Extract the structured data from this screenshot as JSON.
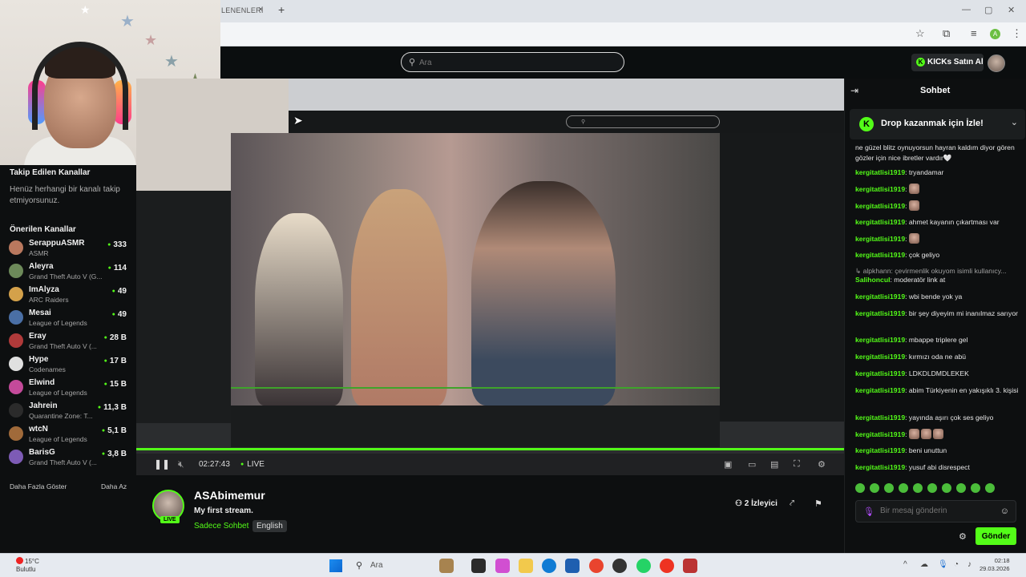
{
  "browser": {
    "tab_title": "LENENLERİ",
    "tab_close": "×",
    "new_tab": "+",
    "window_controls": [
      "—",
      "▢",
      "✕"
    ],
    "toolbar_icons": [
      "star-icon",
      "extensions-icon",
      "media-icon"
    ],
    "profile_initial": "A",
    "menu": "⋮"
  },
  "header": {
    "search_placeholder": "Ara",
    "kicks_button": "KICKs Satın Al"
  },
  "sidebar": {
    "followed_title": "Takip Edilen Kanallar",
    "followed_empty": "Henüz herhangi bir kanalı takip etmiyorsunuz.",
    "recommended_title": "Önerilen Kanallar",
    "channels": [
      {
        "name": "SerappuASMR",
        "game": "ASMR",
        "viewers": "333",
        "color": "#b9785e"
      },
      {
        "name": "Aleyra",
        "game": "Grand Theft Auto V (G...",
        "viewers": "114",
        "color": "#6d8a5a"
      },
      {
        "name": "ImAlyza",
        "game": "ARC Raiders",
        "viewers": "49",
        "color": "#d4a14a"
      },
      {
        "name": "Mesai",
        "game": "League of Legends",
        "viewers": "49",
        "color": "#4a6fa5"
      },
      {
        "name": "Eray",
        "game": "Grand Theft Auto V (...",
        "viewers": "28 B",
        "color": "#b03a3a"
      },
      {
        "name": "Hype",
        "game": "Codenames",
        "viewers": "17 B",
        "color": "#e0e0e0"
      },
      {
        "name": "Elwind",
        "game": "League of Legends",
        "viewers": "15 B",
        "color": "#c44a9a"
      },
      {
        "name": "Jahrein",
        "game": "Quarantine Zone: T...",
        "viewers": "11,3 B",
        "color": "#2b2b2b"
      },
      {
        "name": "wtcN",
        "game": "League of Legends",
        "viewers": "5,1 B",
        "color": "#a06a3a"
      },
      {
        "name": "BarisG",
        "game": "Grand Theft Auto V (...",
        "viewers": "3,8 B",
        "color": "#7d5bb5"
      }
    ],
    "show_more": "Daha Fazla Göster",
    "show_less": "Daha Az"
  },
  "player": {
    "time": "02:27:43",
    "live": "LIVE",
    "progress": 1.0
  },
  "stream_info": {
    "streamer": "ASAbimemur",
    "title": "My first stream.",
    "category": "Sadece Sohbet",
    "language": "English",
    "live_badge": "LIVE",
    "viewers": "2 İzleyici"
  },
  "chat": {
    "title": "Sohbet",
    "drop_banner": "Drop kazanmak için İzle!",
    "messages": [
      {
        "user": "",
        "text": "ne güzel blitz oynuyorsun hayran kaldım diyor gören gözler için nice ibretler vardır🤍",
        "emotes": 0
      },
      {
        "user": "kergitatlisi1919",
        "text": "tryandamar",
        "emotes": 0
      },
      {
        "user": "kergitatlisi1919",
        "text": "",
        "emotes": 1
      },
      {
        "user": "kergitatlisi1919",
        "text": "",
        "emotes": 1
      },
      {
        "user": "kergitatlisi1919",
        "text": "ahmet kayanın çıkartması var",
        "emotes": 0
      },
      {
        "user": "kergitatlisi1919",
        "text": "",
        "emotes": 1
      },
      {
        "user": "kergitatlisi1919",
        "text": "çok geliyo",
        "emotes": 0
      },
      {
        "user": "",
        "text": "↳ alpkhann: çevirmenlik okuyom isimli kullanıcy...",
        "emotes": 0,
        "system": true
      },
      {
        "user": "Salihoncul",
        "text": "moderatör link at",
        "emotes": 0
      },
      {
        "user": "kergitatlisi1919",
        "text": "wbi bende yok ya",
        "emotes": 0
      },
      {
        "user": "kergitatlisi1919",
        "text": "bir şey diyeyim mi inanılmaz sarıyor",
        "emotes": 0
      },
      {
        "user": "kergitatlisi1919",
        "text": "mbappe triplere gel",
        "emotes": 0
      },
      {
        "user": "kergitatlisi1919",
        "text": "kırmızı oda ne abü",
        "emotes": 0
      },
      {
        "user": "kergitatlisi1919",
        "text": "LDKDLDMDLEKEK",
        "emotes": 0
      },
      {
        "user": "kergitatlisi1919",
        "text": "abim Türkiyenin en yakışıklı 3. kişisi",
        "emotes": 0
      },
      {
        "user": "kergitatlisi1919",
        "text": "yayında aşırı çok ses geliyo",
        "emotes": 0
      },
      {
        "user": "kergitatlisi1919",
        "text": "",
        "emotes": 3
      },
      {
        "user": "kergitatlisi1919",
        "text": "beni unuttun",
        "emotes": 0
      },
      {
        "user": "kergitatlisi1919",
        "text": "yusuf abi disrespect",
        "emotes": 0
      }
    ],
    "input_placeholder": "Bir mesaj gönderin",
    "send_button": "Gönder"
  },
  "taskbar": {
    "weather_temp": "15°C",
    "weather_desc": "Bulutlu",
    "search_label": "Ara",
    "time": "02:18",
    "date": "29.03.2026"
  },
  "colors": {
    "accent": "#53fc18",
    "background": "#0d0f10"
  }
}
